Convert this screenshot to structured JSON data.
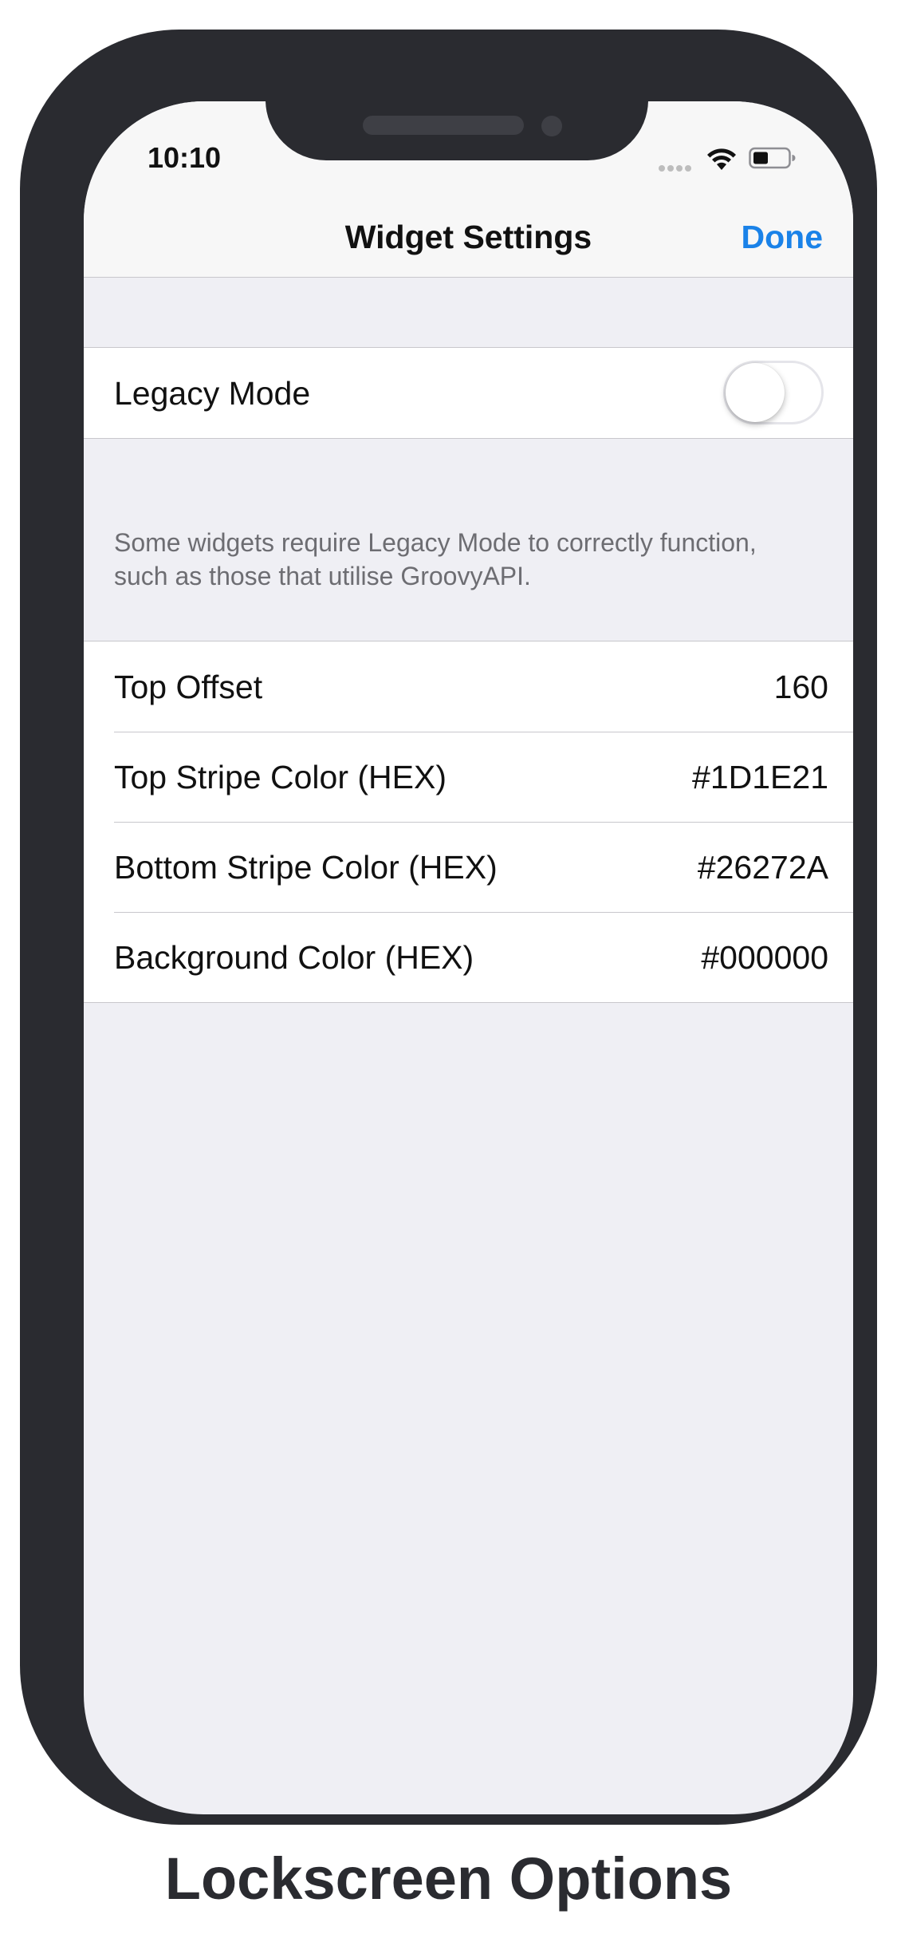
{
  "status_bar": {
    "time": "10:10"
  },
  "nav": {
    "title": "Widget Settings",
    "done_label": "Done"
  },
  "legacy_section": {
    "label": "Legacy Mode",
    "toggle_on": false,
    "footer": "Some widgets require Legacy Mode to correctly function, such as those that utilise GroovyAPI."
  },
  "settings": [
    {
      "label": "Top Offset",
      "value": "160"
    },
    {
      "label": "Top Stripe Color (HEX)",
      "value": "#1D1E21"
    },
    {
      "label": "Bottom Stripe Color (HEX)",
      "value": "#26272A"
    },
    {
      "label": "Background Color (HEX)",
      "value": "#000000"
    }
  ],
  "caption": "Lockscreen Options",
  "colors": {
    "accent": "#1a82e8",
    "frame": "#2a2b30",
    "background": "#efeff4"
  },
  "icons": [
    "signal-icon",
    "wifi-icon",
    "battery-icon"
  ]
}
